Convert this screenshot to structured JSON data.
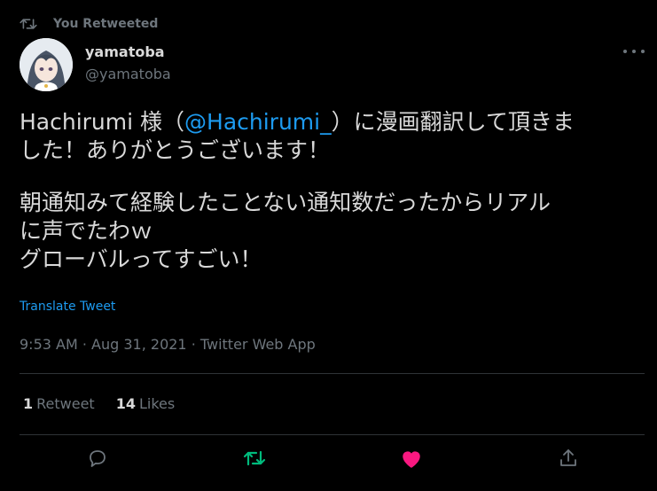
{
  "retweet_header": {
    "label": "You Retweeted",
    "icon": "retweet-icon"
  },
  "author": {
    "name": "yamatoba",
    "handle": "@yamatoba",
    "avatar_icon": "avatar-anime-girl"
  },
  "tweet": {
    "line1_prefix": "Hachirumi 様（",
    "line1_mention": "@Hachirumi_",
    "line1_suffix": "）に漫画翻訳して頂きま",
    "line2": "した！ありがとうございます！",
    "line3": "朝通知みて経験したことない通知数だったからリアル",
    "line4": "に声でたわｗ",
    "line5": "グローバルってすごい！",
    "translate_label": "Translate Tweet",
    "meta": "9:53 AM · Aug 31, 2021 · Twitter Web App"
  },
  "stats": {
    "retweets_count": "1",
    "retweets_label": "Retweet",
    "likes_count": "14",
    "likes_label": "Likes"
  },
  "actions": {
    "reply_icon": "reply-icon",
    "retweet_icon": "retweet-icon",
    "like_icon": "heart-icon",
    "share_icon": "share-icon"
  },
  "colors": {
    "background": "#000000",
    "text": "#d9d9d9",
    "muted": "#6e767d",
    "link": "#1d9bf0",
    "retweet_active": "#00ba7c",
    "like_active": "#f91880",
    "divider": "#2f3336"
  }
}
